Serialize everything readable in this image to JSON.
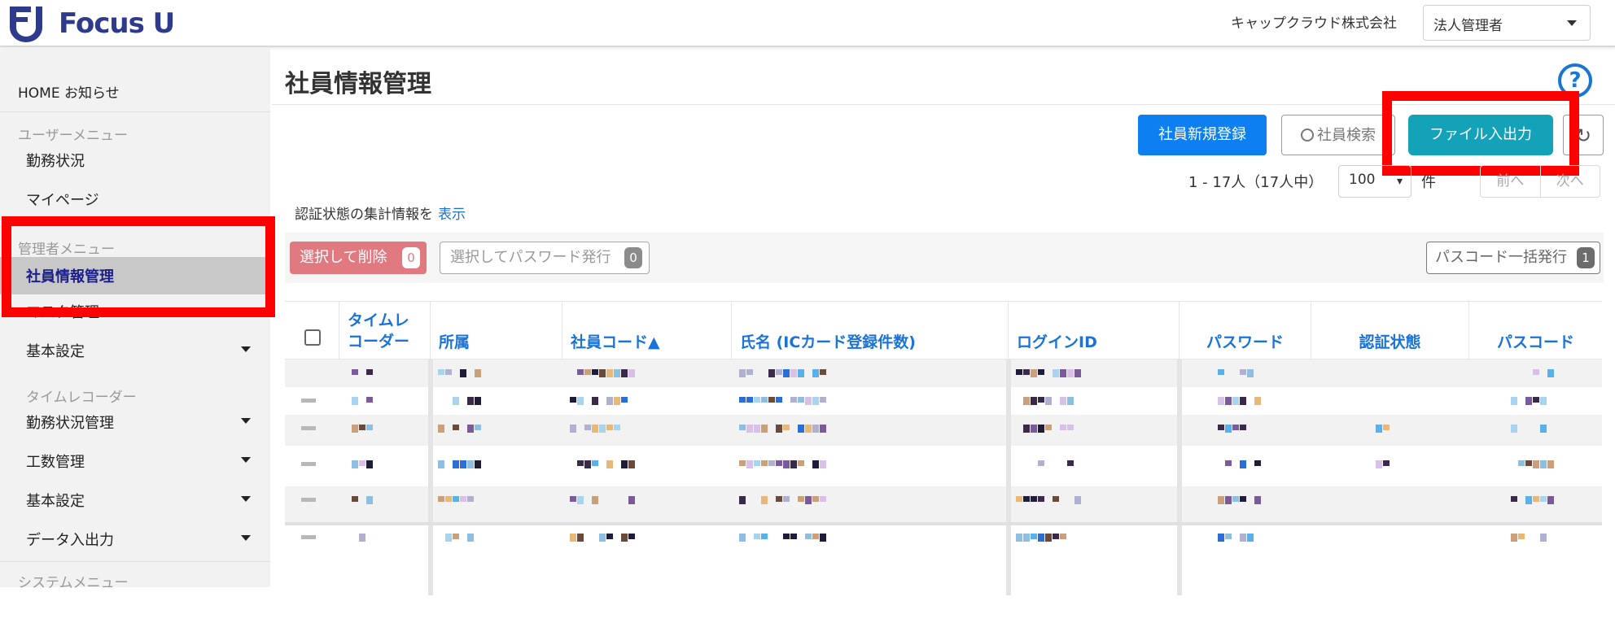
{
  "header": {
    "logo_text": "Focus U",
    "company": "キャップクラウド株式会社",
    "role": "法人管理者"
  },
  "sidebar": {
    "home": "HOME お知らせ",
    "user_menu_label": "ユーザーメニュー",
    "user_items": [
      "勤務状況",
      "マイページ"
    ],
    "admin_menu_label": "管理者メニュー",
    "admin_items": [
      "社員情報管理",
      "マスタ管理",
      "基本設定"
    ],
    "time_recorder_label": "タイムレコーダー",
    "time_items": [
      "勤務状況管理",
      "工数管理",
      "基本設定",
      "データ入出力"
    ],
    "system_menu_label": "システムメニュー"
  },
  "main": {
    "page_title": "社員情報管理",
    "help_glyph": "?",
    "buttons": {
      "new_employee": "社員新規登録",
      "search": "社員検索",
      "file_io": "ファイル入出力",
      "refresh_glyph": "↻"
    },
    "count_text": "1 - 17人（17人中）",
    "per_page": "100",
    "per_page_unit": "件",
    "pager": {
      "prev": "前へ",
      "next": "次へ"
    },
    "auth_info_text": "認証状態の集計情報を",
    "auth_info_link": "表示",
    "toolbar": {
      "delete_selected": "選択して削除",
      "delete_count": "0",
      "issue_password": "選択してパスワード発行",
      "issue_count": "0",
      "bulk_passcode": "パスコード一括発行",
      "bulk_count": "1"
    },
    "table": {
      "columns": [
        "タイムレコーダー",
        "所属",
        "社員コード▲",
        "氏名 (ICカード登録件数)",
        "ログインID",
        "パスワード",
        "認証状態",
        "パスコード"
      ]
    }
  },
  "colors": {
    "primary": "#0d7ff0",
    "teal": "#13a2b8",
    "danger_light": "#e07a80",
    "highlight": "#ff0000",
    "link": "#1a73d9",
    "logo": "#2e3a8c"
  }
}
